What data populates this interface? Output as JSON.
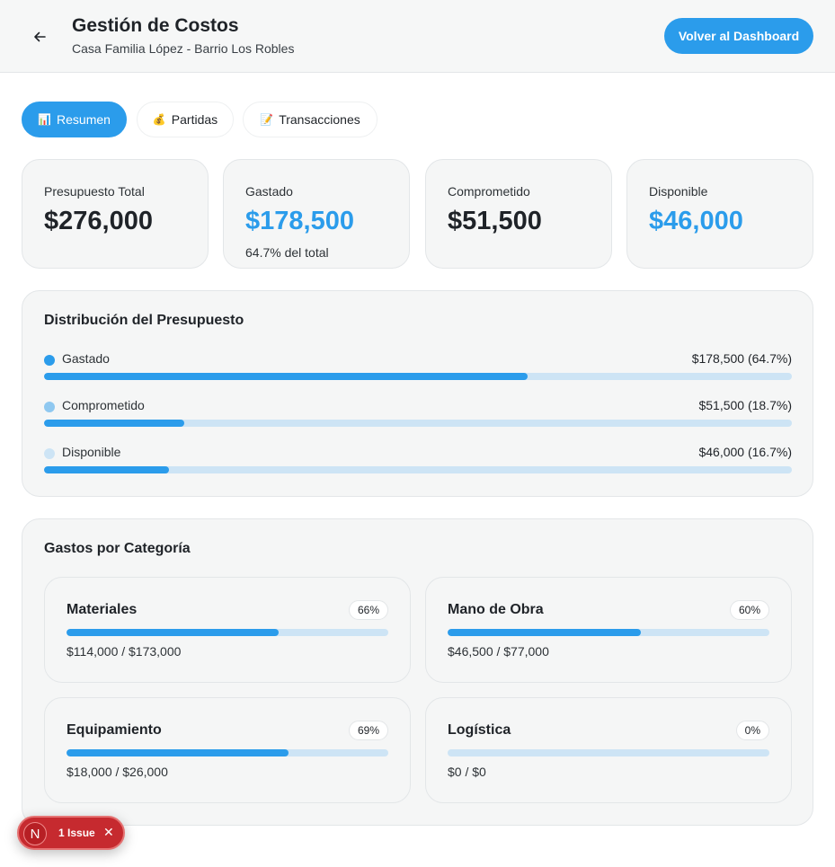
{
  "header": {
    "title": "Gestión de Costos",
    "subtitle": "Casa Familia López - Barrio Los Robles",
    "dashboard_button": "Volver al Dashboard",
    "back_icon": "arrow-left-icon"
  },
  "tabs": [
    {
      "label": "Resumen",
      "icon": "📊",
      "active": true
    },
    {
      "label": "Partidas",
      "icon": "💰",
      "active": false
    },
    {
      "label": "Transacciones",
      "icon": "📝",
      "active": false
    }
  ],
  "summary": {
    "total": {
      "label": "Presupuesto Total",
      "value": "$276,000"
    },
    "spent": {
      "label": "Gastado",
      "value": "$178,500",
      "note": "64.7% del total"
    },
    "committed": {
      "label": "Comprometido",
      "value": "$51,500"
    },
    "available": {
      "label": "Disponible",
      "value": "$46,000"
    }
  },
  "distribution": {
    "title": "Distribución del Presupuesto",
    "rows": [
      {
        "label": "Gastado",
        "value": "$178,500 (64.7%)",
        "percent": 64.7,
        "dot_color": "#2b9ceb"
      },
      {
        "label": "Comprometido",
        "value": "$51,500 (18.7%)",
        "percent": 18.7,
        "dot_color": "#8fc8f0"
      },
      {
        "label": "Disponible",
        "value": "$46,000 (16.7%)",
        "percent": 16.7,
        "dot_color": "#cde4f5"
      }
    ]
  },
  "categories": {
    "title": "Gastos por Categoría",
    "items": [
      {
        "name": "Materiales",
        "badge": "66%",
        "percent": 66,
        "amount": "$114,000 / $173,000"
      },
      {
        "name": "Mano de Obra",
        "badge": "60%",
        "percent": 60,
        "amount": "$46,500 / $77,000"
      },
      {
        "name": "Equipamiento",
        "badge": "69%",
        "percent": 69,
        "amount": "$18,000 / $26,000"
      },
      {
        "name": "Logística",
        "badge": "0%",
        "percent": 0,
        "amount": "$0 / $0"
      }
    ]
  },
  "issue_toast": {
    "avatar": "N",
    "text": "1 Issue"
  },
  "colors": {
    "accent": "#2b9ceb",
    "track": "#cde4f5",
    "issue": "#c62a2f"
  }
}
